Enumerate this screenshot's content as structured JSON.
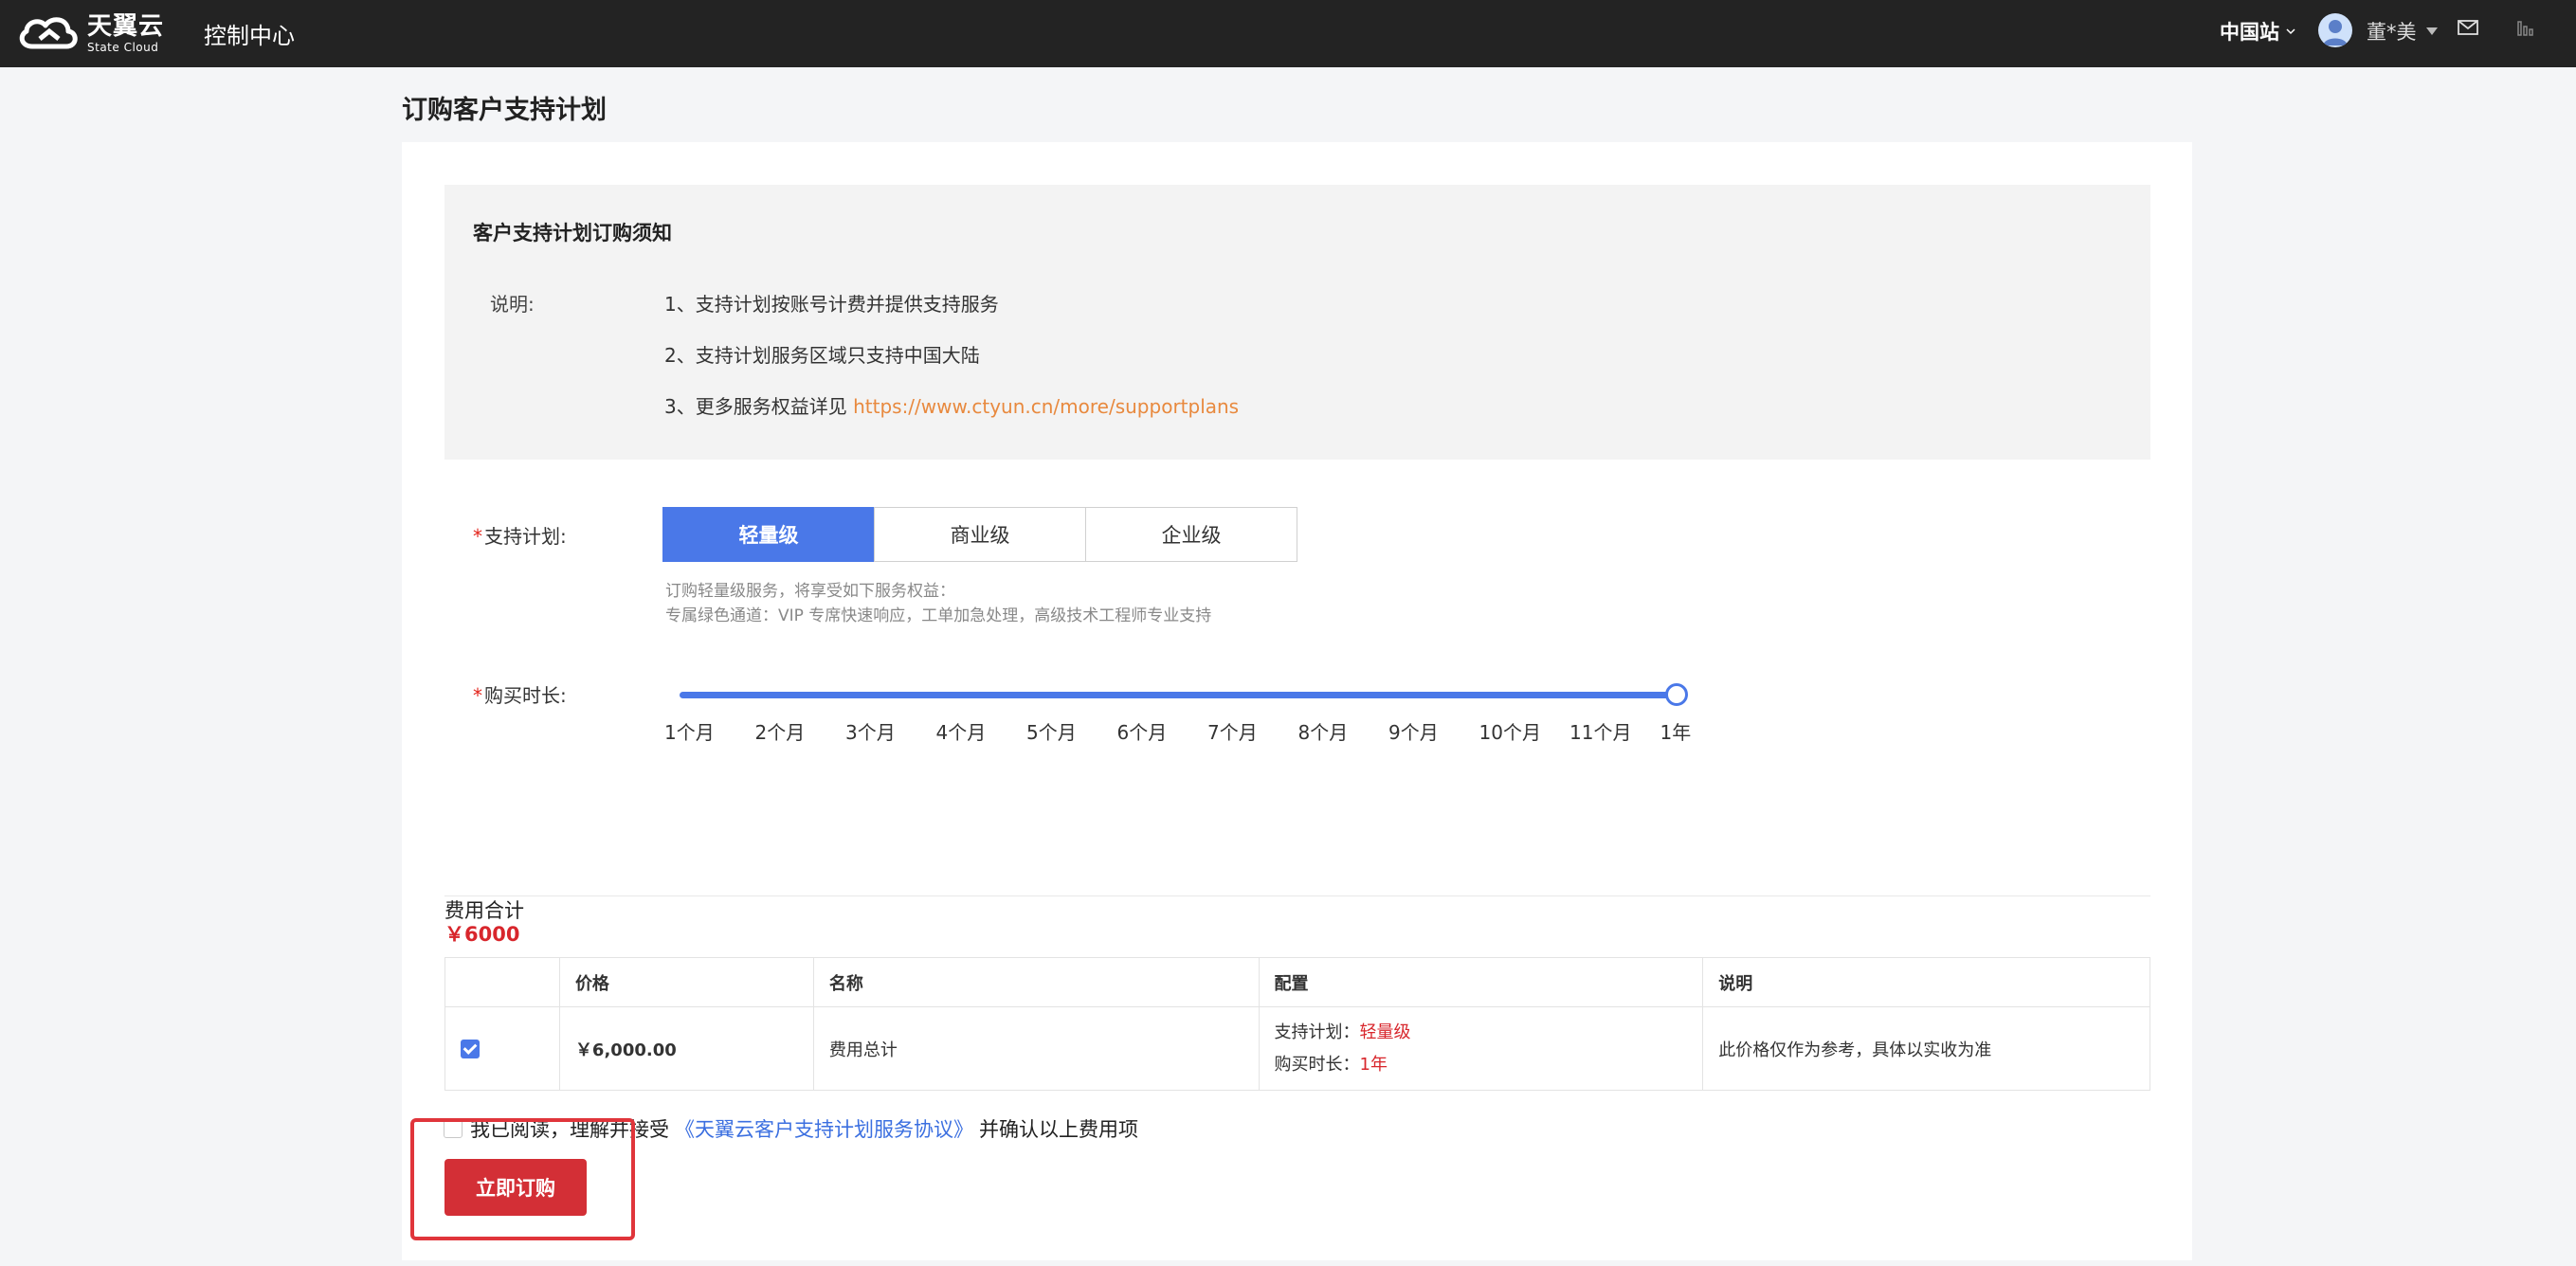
{
  "header": {
    "logo_cn": "天翼云",
    "logo_en": "State Cloud",
    "console_title": "控制中心",
    "region": "中国站",
    "username": "董*美"
  },
  "page": {
    "title": "订购客户支持计划"
  },
  "notice": {
    "title": "客户支持计划订购须知",
    "label": "说明:",
    "items": [
      "1、支持计划按账号计费并提供支持服务",
      "2、支持计划服务区域只支持中国大陆",
      "3、更多服务权益详见"
    ],
    "link": "https://www.ctyun.cn/more/supportplans"
  },
  "plan": {
    "label": "支持计划:",
    "options": [
      "轻量级",
      "商业级",
      "企业级"
    ],
    "selected": "轻量级",
    "desc_line1": "订购轻量级服务，将享受如下服务权益：",
    "desc_line2": "专属绿色通道：VIP 专席快速响应，工单加急处理，高级技术工程师专业支持"
  },
  "duration": {
    "label": "购买时长:",
    "ticks": [
      "1个月",
      "2个月",
      "3个月",
      "4个月",
      "5个月",
      "6个月",
      "7个月",
      "8个月",
      "9个月",
      "10个月",
      "11个月",
      "1年"
    ],
    "selected": "1年"
  },
  "total": {
    "label": "费用合计",
    "value": "￥6000"
  },
  "table": {
    "headers": [
      "",
      "价格",
      "名称",
      "配置",
      "说明"
    ],
    "row": {
      "price": "￥6,000.00",
      "name": "费用总计",
      "cfg_plan_label": "支持计划：",
      "cfg_plan_value": "轻量级",
      "cfg_dur_label": "购买时长：",
      "cfg_dur_value": "1年",
      "note": "此价格仅作为参考，具体以实收为准"
    }
  },
  "agreement": {
    "prefix": "我已阅读，理解并接受",
    "link": "《天翼云客户支持计划服务协议》",
    "suffix": "并确认以上费用项"
  },
  "buy_button": "立即订购",
  "colors": {
    "accent": "#4a78e8",
    "danger": "#d32f36",
    "link_orange": "#e8893e"
  }
}
